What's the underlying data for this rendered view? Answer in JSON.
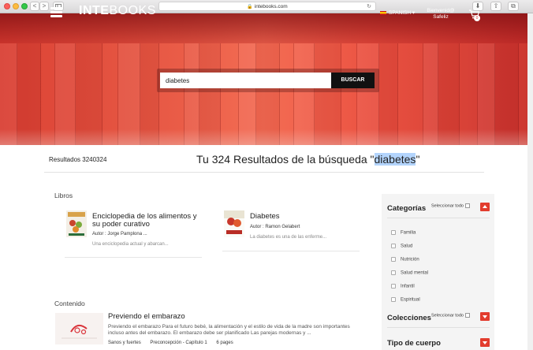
{
  "browser": {
    "url": "intebooks.com",
    "nav_back": "<",
    "nav_forward": ">"
  },
  "header": {
    "logo_bold": "INTE",
    "logo_rest": "BOOKS",
    "language": "SPANISH",
    "welcome_line1": "Bienvenid@",
    "welcome_line2": "Safeliz",
    "cart_count": "0"
  },
  "search": {
    "value": "diabetes",
    "button_label": "BUSCAR"
  },
  "results": {
    "count_label": "Resultados 3240324",
    "title_prefix": "Tu 324 Resultados de la búsqueda \"",
    "title_query": "diabetes",
    "title_suffix": "\""
  },
  "books_section": {
    "label": "Libros",
    "items": [
      {
        "title": "Enciclopedia de los alimentos y su poder curativo",
        "author": "Autor : Jorge Pamplona ...",
        "desc": "Una enciclopedia actual y abarcan..."
      },
      {
        "title": "Diabetes",
        "author": "Autor : Ramon Gelabert",
        "desc": "La diabetes es una de las enferme..."
      }
    ]
  },
  "content_section": {
    "label": "Contenido",
    "items": [
      {
        "title": "Previendo el embarazo",
        "desc": "Previendo el embarazo Para el futuro bebé, la alimentación y el estilo de vida de la madre son importantes incluso antes del embarazo. El embarazo debe ser planificado Las parejas modernas y ...",
        "meta": [
          "Sanos y fuertes",
          "Preconcepción - Capítulo 1",
          "6 pages"
        ]
      }
    ]
  },
  "sidebar": {
    "categorias": {
      "title": "Categorías",
      "select_all": "Seleccionar todo",
      "items": [
        "Familia",
        "Salud",
        "Nutrición",
        "Salud mental",
        "Infantil",
        "Espiritual"
      ]
    },
    "colecciones": {
      "title": "Colecciones",
      "select_all": "Seleccionar todo"
    },
    "tipo": {
      "title": "Tipo de cuerpo"
    }
  },
  "colors": {
    "accent": "#e23c2d",
    "hero_red": "#e95a45",
    "highlight": "#b3d4fc"
  }
}
